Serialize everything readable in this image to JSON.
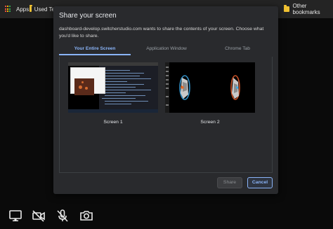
{
  "bookmarks": {
    "apps_label": "Apps",
    "item_used_label": "Used Te",
    "other_label": "Other bookmarks"
  },
  "dialog": {
    "title": "Share your screen",
    "description": "dashboard-develop.switcherstudio.com wants to share the contents of your screen. Choose what you'd like to share.",
    "tabs": [
      {
        "label": "Your Entire Screen",
        "active": true
      },
      {
        "label": "Application Window",
        "active": false
      },
      {
        "label": "Chrome Tab",
        "active": false
      }
    ],
    "sources": [
      {
        "label": "Screen 1"
      },
      {
        "label": "Screen 2"
      }
    ],
    "buttons": {
      "share": "Share",
      "cancel": "Cancel"
    }
  },
  "toolbar": {
    "icons": [
      "monitor-icon",
      "camera-off-icon",
      "microphone-off-icon",
      "snapshot-camera-icon"
    ]
  },
  "colors": {
    "accent": "#8ab4f8",
    "dialog_bg": "#292a2d",
    "bookmarks_bg": "#242424"
  }
}
